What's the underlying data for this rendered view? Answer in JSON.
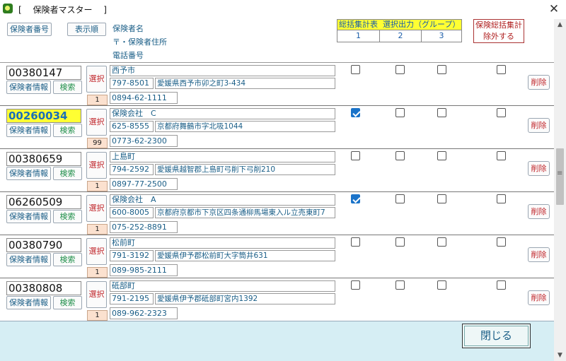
{
  "window": {
    "title": "[　 保険者マスター　 ]",
    "close_glyph": "✕"
  },
  "header": {
    "sort_insurer_number": "保険者番号",
    "sort_display_order": "表示順",
    "col_name": "保険者名",
    "col_address": "〒・保険者住所",
    "col_phone": "電話番号",
    "group_title_prefix": "総括集計表",
    "group_title_suffix": "選択出力（グループ）",
    "group_numbers": [
      "1",
      "2",
      "3"
    ],
    "exclude_label_line1": "保険総括集計",
    "exclude_label_line2": "除外する"
  },
  "row_buttons": {
    "info": "保険者情報",
    "search": "検索",
    "select": "選択",
    "delete": "削除"
  },
  "rows": [
    {
      "code": "00380147",
      "order": "1",
      "name": "西予市",
      "zip": "797-8501",
      "address": "愛媛県西予市卯之町3-434",
      "phone": "0894-62-1111",
      "group1": false,
      "group2": false,
      "group3": false,
      "exclude": false,
      "highlight": false
    },
    {
      "code": "00260034",
      "order": "99",
      "name": "保険会社　C",
      "zip": "625-8555",
      "address": "京都府舞鶴市字北吸1044",
      "phone": "0773-62-2300",
      "group1": true,
      "group2": false,
      "group3": false,
      "exclude": false,
      "highlight": true
    },
    {
      "code": "00380659",
      "order": "1",
      "name": "上島町",
      "zip": "794-2592",
      "address": "愛媛県越智郡上島町弓削下弓削210",
      "phone": "0897-77-2500",
      "group1": false,
      "group2": false,
      "group3": false,
      "exclude": false,
      "highlight": false
    },
    {
      "code": "06260509",
      "order": "1",
      "name": "保険会社　A",
      "zip": "600-8005",
      "address": "京都府京都市下京区四条通柳馬場東入ル立売東町7",
      "phone": "075-252-8891",
      "group1": true,
      "group2": false,
      "group3": false,
      "exclude": false,
      "highlight": false
    },
    {
      "code": "00380790",
      "order": "1",
      "name": "松前町",
      "zip": "791-3192",
      "address": "愛媛県伊予郡松前町大字筒井631",
      "phone": "089-985-2111",
      "group1": false,
      "group2": false,
      "group3": false,
      "exclude": false,
      "highlight": false
    },
    {
      "code": "00380808",
      "order": "1",
      "name": "砥部町",
      "zip": "791-2195",
      "address": "愛媛県伊予郡砥部町宮内1392",
      "phone": "089-962-2323",
      "group1": false,
      "group2": false,
      "group3": false,
      "exclude": false,
      "highlight": false
    }
  ],
  "footer": {
    "close_label": "閉じる"
  },
  "colors": {
    "highlight": "#ffff33",
    "footer_bg": "#d6eef4",
    "checked": "#1a73c9",
    "order_bg": "#fbe1cf"
  }
}
